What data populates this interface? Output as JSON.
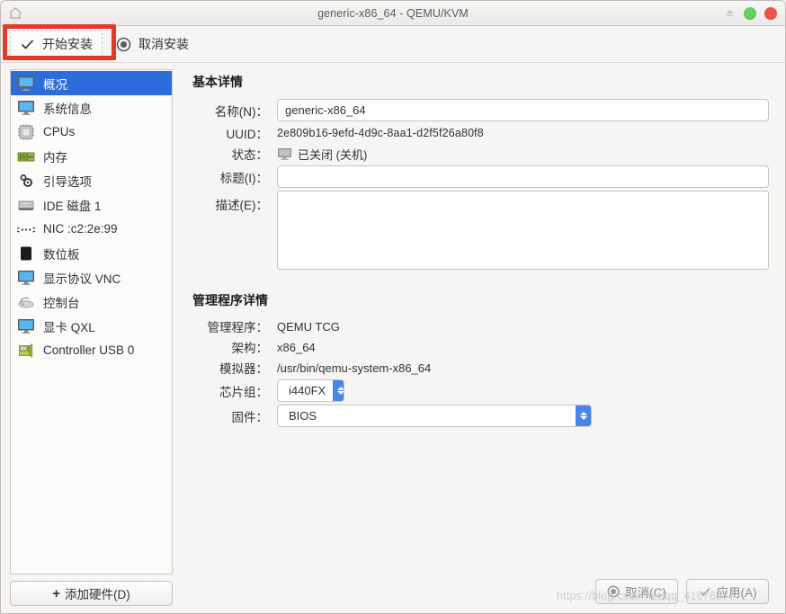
{
  "window": {
    "title": "generic-x86_64 - QEMU/KVM",
    "titlebar_icons": [
      "app-icon",
      "eject-icon",
      "minimize-dot",
      "close-dot"
    ],
    "colors": {
      "selection": "#2d6ddb",
      "highlight_box": "#e03a28",
      "combo_arrow": "#4a86e8",
      "green_dot": "#5ed45e",
      "red_dot": "#ef5350"
    }
  },
  "toolbar": {
    "begin_install_label": "开始安装",
    "cancel_install_label": "取消安装",
    "begin_install_icon": "check-icon",
    "cancel_install_icon": "cancel-circle-icon"
  },
  "sidebar": {
    "items": [
      {
        "label": "概况",
        "icon": "monitor-icon",
        "selected": true
      },
      {
        "label": "系统信息",
        "icon": "monitor-icon",
        "selected": false
      },
      {
        "label": "CPUs",
        "icon": "cpu-chip-icon",
        "selected": false
      },
      {
        "label": "内存",
        "icon": "memory-icon",
        "selected": false
      },
      {
        "label": "引导选项",
        "icon": "gear-icon",
        "selected": false
      },
      {
        "label": "IDE 磁盘 1",
        "icon": "hard-disk-icon",
        "selected": false
      },
      {
        "label": "NIC :c2:2e:99",
        "icon": "network-icon",
        "selected": false
      },
      {
        "label": "数位板",
        "icon": "tablet-icon",
        "selected": false
      },
      {
        "label": "显示协议 VNC",
        "icon": "display-icon",
        "selected": false
      },
      {
        "label": "控制台",
        "icon": "console-icon",
        "selected": false
      },
      {
        "label": "显卡 QXL",
        "icon": "video-card-icon",
        "selected": false
      },
      {
        "label": "Controller USB 0",
        "icon": "usb-controller-icon",
        "selected": false
      }
    ],
    "add_hardware_label": "添加硬件(D)"
  },
  "basic_details": {
    "section_title": "基本详情",
    "name_label": "名称(N)：",
    "name_value": "generic-x86_64",
    "uuid_label": "UUID：",
    "uuid_value": "2e809b16-9efd-4d9c-8aa1-d2f5f26a80f8",
    "state_label": "状态：",
    "state_value": "已关闭 (关机)",
    "state_icon": "monitor-off-icon",
    "title_label": "标题(I)：",
    "title_value": "",
    "description_label": "描述(E)：",
    "description_value": ""
  },
  "hypervisor_details": {
    "section_title": "管理程序详情",
    "hypervisor_label": "管理程序：",
    "hypervisor_value": "QEMU TCG",
    "arch_label": "架构：",
    "arch_value": "x86_64",
    "emulator_label": "模拟器：",
    "emulator_value": "/usr/bin/qemu-system-x86_64",
    "chipset_label": "芯片组：",
    "chipset_value": "i440FX",
    "firmware_label": "固件：",
    "firmware_value": "BIOS"
  },
  "footer": {
    "cancel_label": "取消(C)",
    "apply_label": "应用(A)",
    "cancel_icon": "cancel-circle-icon",
    "apply_icon": "check-icon"
  },
  "watermark": "https://blog.csdn.net/qq_41676577"
}
